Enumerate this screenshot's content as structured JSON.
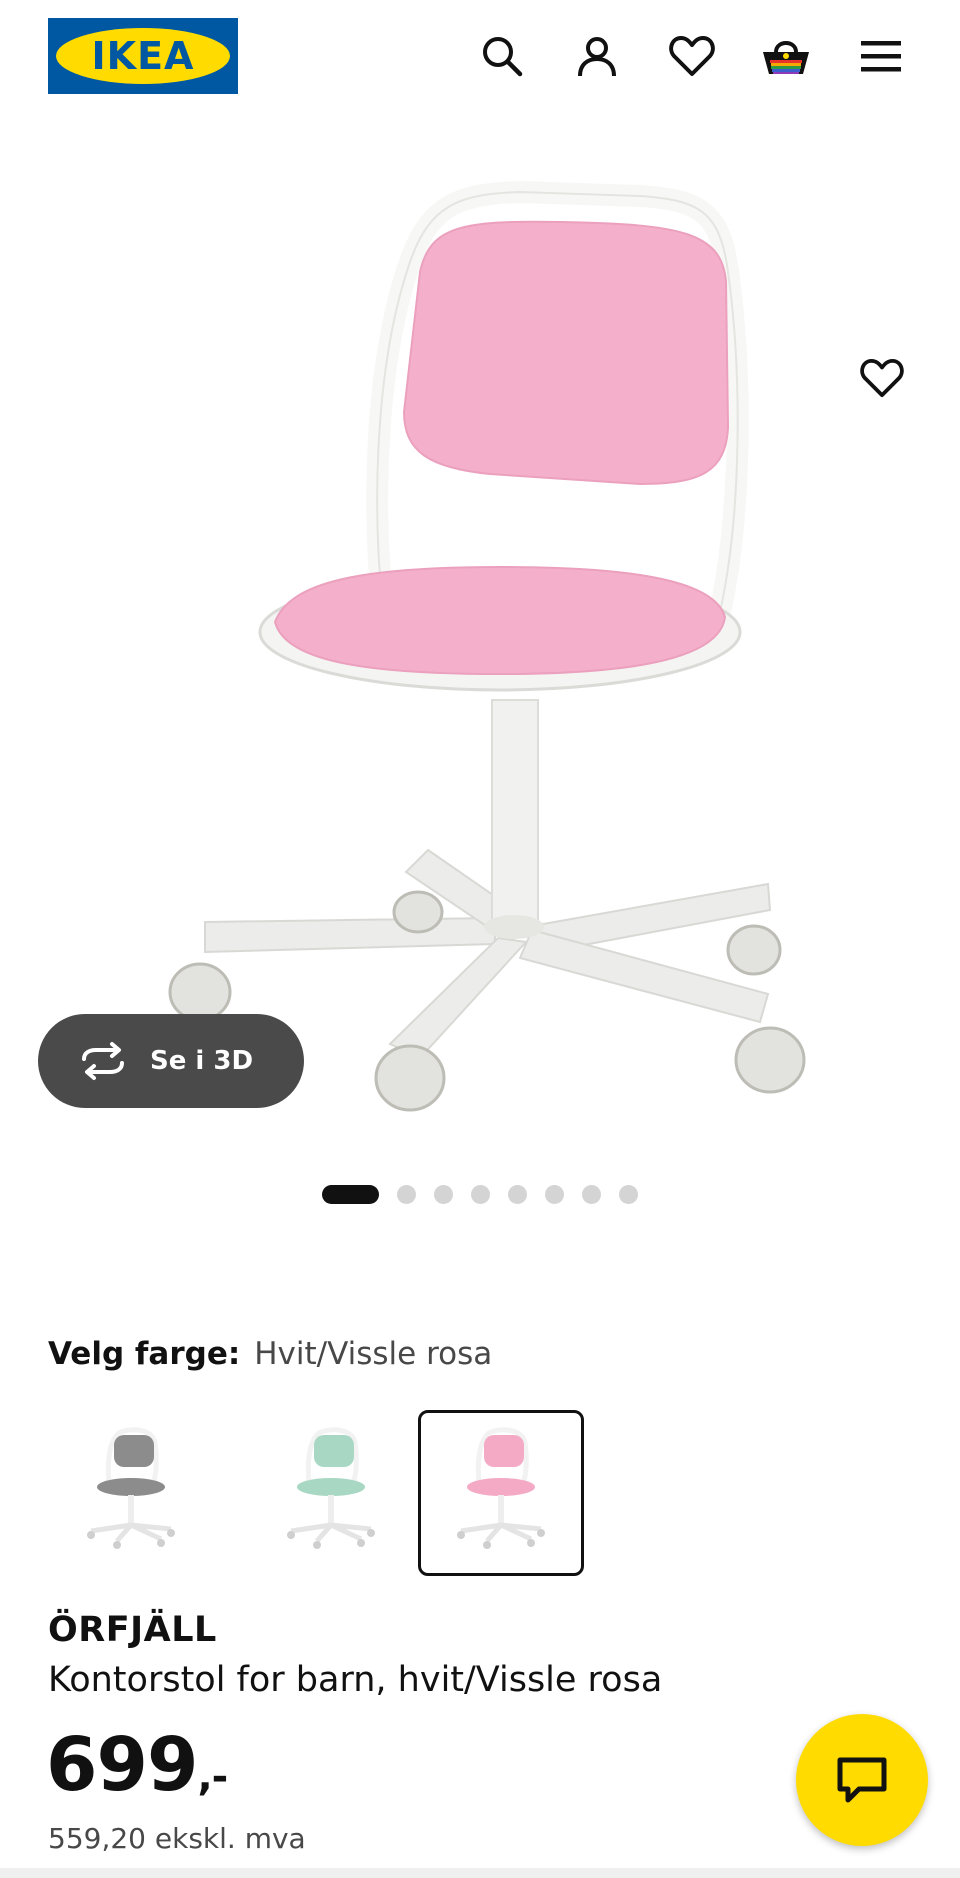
{
  "header": {
    "logo_text": "IKEA",
    "icons": [
      "search-icon",
      "user-icon",
      "heart-icon",
      "basket-icon",
      "menu-icon"
    ]
  },
  "gallery": {
    "view_3d_label": "Se i 3D",
    "slide_count": 8,
    "active_slide": 1
  },
  "color": {
    "label": "Velg farge:",
    "value": "Hvit/Vissle rosa",
    "variants": [
      {
        "name": "grey",
        "seat_color": "#8c8c8c",
        "selected": false
      },
      {
        "name": "green",
        "seat_color": "#a8d8c4",
        "selected": false
      },
      {
        "name": "pink",
        "seat_color": "#f4a9c5",
        "selected": true
      }
    ]
  },
  "product": {
    "name": "ÖRFJÄLL",
    "description": "Kontorstol for barn, hvit/Vissle rosa",
    "price": "699",
    "price_suffix": ",-",
    "price_ex_vat": "559,20 ekskl. mva"
  },
  "colors": {
    "ikea_blue": "#0058a3",
    "ikea_yellow": "#ffdb00",
    "seat_pink": "#f4a9c5"
  }
}
